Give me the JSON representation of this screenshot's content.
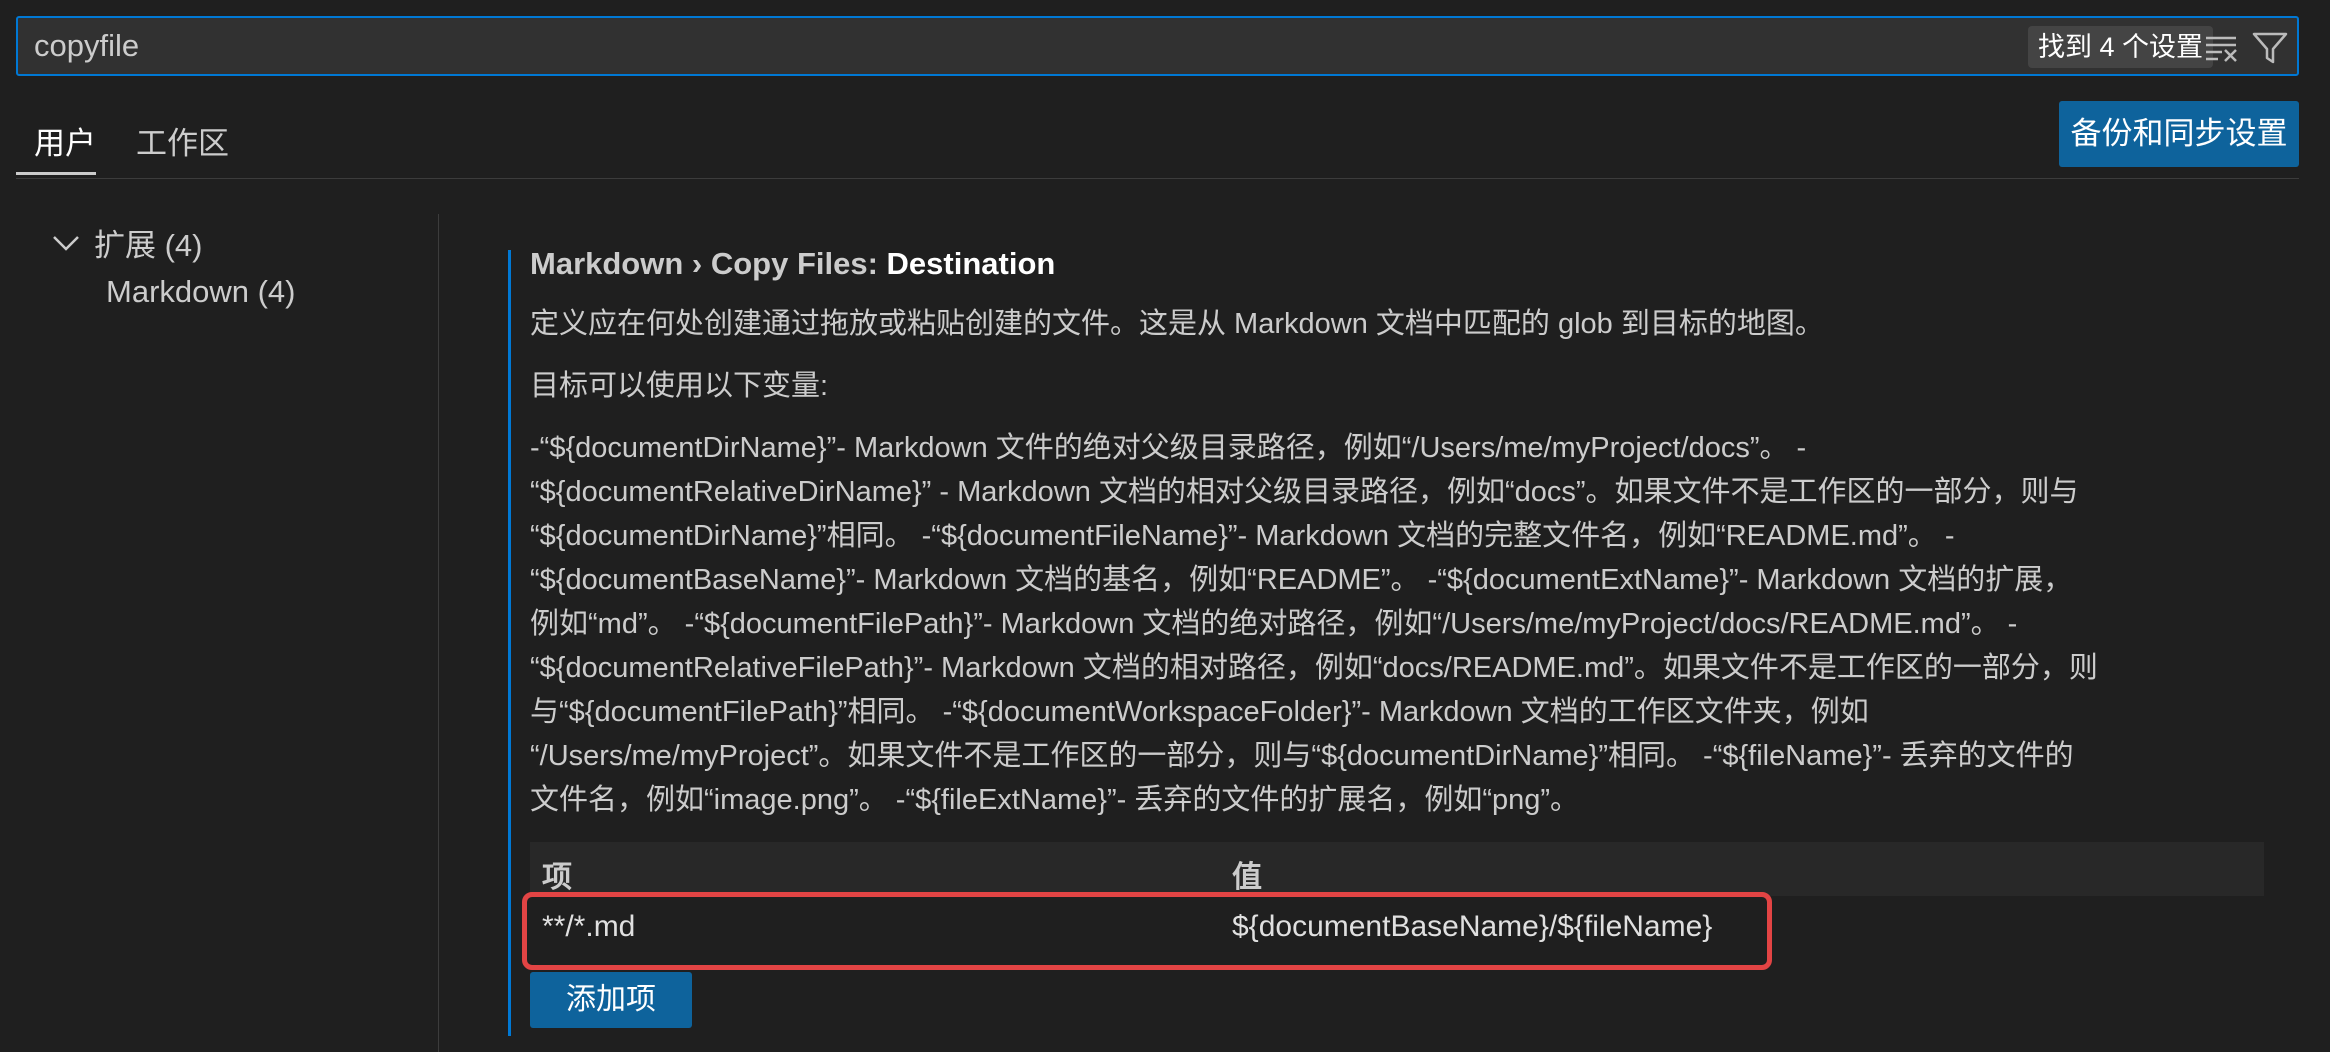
{
  "search": {
    "value": "copyfile",
    "result_count": "找到 4 个设置",
    "clear_filter_icon": "clear-filter-icon",
    "filter_icon": "filter-icon"
  },
  "tabs": {
    "user": "用户",
    "workspace": "工作区"
  },
  "sync_button": "备份和同步设置",
  "toc": {
    "group_label": "扩展 (4)",
    "item_label": "Markdown (4)"
  },
  "setting": {
    "title_prefix": "Markdown › Copy Files: ",
    "title_name": "Destination",
    "description": "定义应在何处创建通过拖放或粘贴创建的文件。这是从 Markdown 文档中匹配的 glob 到目标的地图。",
    "variables_intro": "目标可以使用以下变量:",
    "variables_text": "-“${documentDirName}”- Markdown 文件的绝对父级目录路径，例如“/Users/me/myProject/docs”。 -\n“${documentRelativeDirName}” - Markdown 文档的相对父级目录路径，例如“docs”。如果文件不是工作区的一部分，则与\n“${documentDirName}”相同。 -“${documentFileName}”- Markdown 文档的完整文件名，例如“README.md”。 -\n“${documentBaseName}”- Markdown 文档的基名，例如“README”。 -“${documentExtName}”- Markdown 文档的扩展，\n例如“md”。 -“${documentFilePath}”- Markdown 文档的绝对路径，例如“/Users/me/myProject/docs/README.md”。 -\n“${documentRelativeFilePath}”- Markdown 文档的相对路径，例如“docs/README.md”。如果文件不是工作区的一部分，则\n与“${documentFilePath}”相同。 -“${documentWorkspaceFolder}”- Markdown 文档的工作区文件夹，例如\n“/Users/me/myProject”。如果文件不是工作区的一部分，则与“${documentDirName}”相同。 -“${fileName}”- 丢弃的文件的\n文件名，例如“image.png”。 -“${fileExtName}”- 丢弃的文件的扩展名，例如“png”。"
  },
  "table": {
    "header_key": "项",
    "header_value": "值",
    "rows": [
      {
        "key": "**/*.md",
        "value": "${documentBaseName}/${fileName}"
      }
    ],
    "add_button": "添加项"
  },
  "colors": {
    "accent": "#0078d4",
    "button": "#0e639c",
    "highlight": "#e24444",
    "background": "#1f1f1f"
  }
}
